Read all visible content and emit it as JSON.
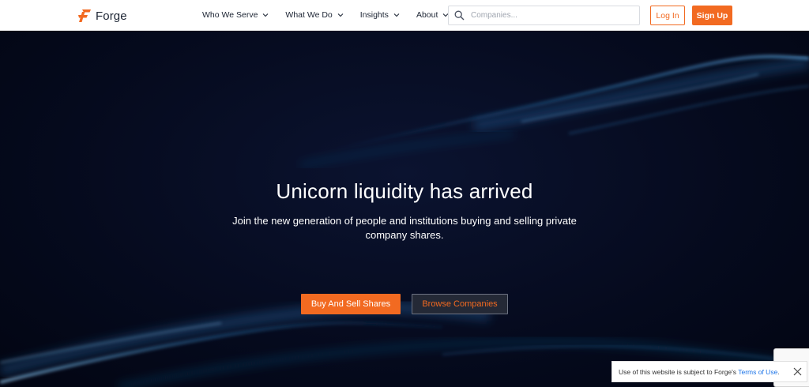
{
  "brand": {
    "name": "Forge",
    "accent": "#f26a21",
    "dark_bg": "#050a1d"
  },
  "nav": {
    "items": [
      {
        "label": "Who We Serve",
        "icon": "chevron-down-icon"
      },
      {
        "label": "What We Do",
        "icon": "chevron-down-icon"
      },
      {
        "label": "Insights",
        "icon": "chevron-down-icon"
      },
      {
        "label": "About",
        "icon": "chevron-down-icon"
      }
    ]
  },
  "search": {
    "placeholder": "Companies...",
    "value": "",
    "icon": "search-icon"
  },
  "auth": {
    "login_label": "Log In",
    "signup_label": "Sign Up"
  },
  "hero": {
    "title": "Unicorn liquidity has arrived",
    "subtitle": "Join the new generation of people and institutions buying and selling private company shares.",
    "primary_cta": "Buy And Sell Shares",
    "secondary_cta": "Browse Companies"
  },
  "cookie_notice": {
    "text": "Use of this website is subject to Forge's ",
    "link": "Terms of Use",
    "suffix": "."
  }
}
